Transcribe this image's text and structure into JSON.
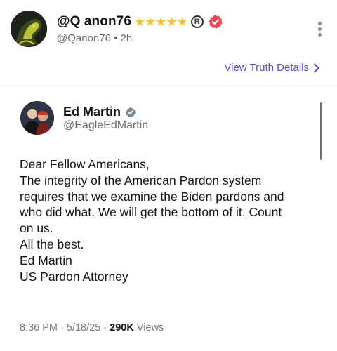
{
  "post": {
    "display_name": "@Q anon76",
    "stars": "★★★★★",
    "reg_mark": "R",
    "handle": "@Qanon76",
    "separator": " • ",
    "age": "2h",
    "details_link": "View Truth Details"
  },
  "quote": {
    "name": "Ed Martin",
    "handle": "@EagleEdMartin",
    "lines": [
      "Dear Fellow Americans,",
      "The integrity of the American Pardon system",
      "requires that we examine the Biden pardons and",
      "who did what. We will get the bottom of it. Count",
      "on us.",
      "All the best.",
      "Ed Martin",
      "US Pardon Attorney"
    ],
    "time": "8:36 PM",
    "dot": " · ",
    "date": "5/18/25",
    "dot2": " · ",
    "views_count": "290K",
    "views_label": " Views"
  },
  "colors": {
    "link": "#5a4fd1",
    "verified_main": "#e8484f",
    "verified_quote": "#7a8794",
    "stars": "#f6c33a"
  },
  "icons": {
    "more": "kebab-menu-icon",
    "chevron": "chevron-right-icon",
    "verified": "verified-badge-icon"
  }
}
